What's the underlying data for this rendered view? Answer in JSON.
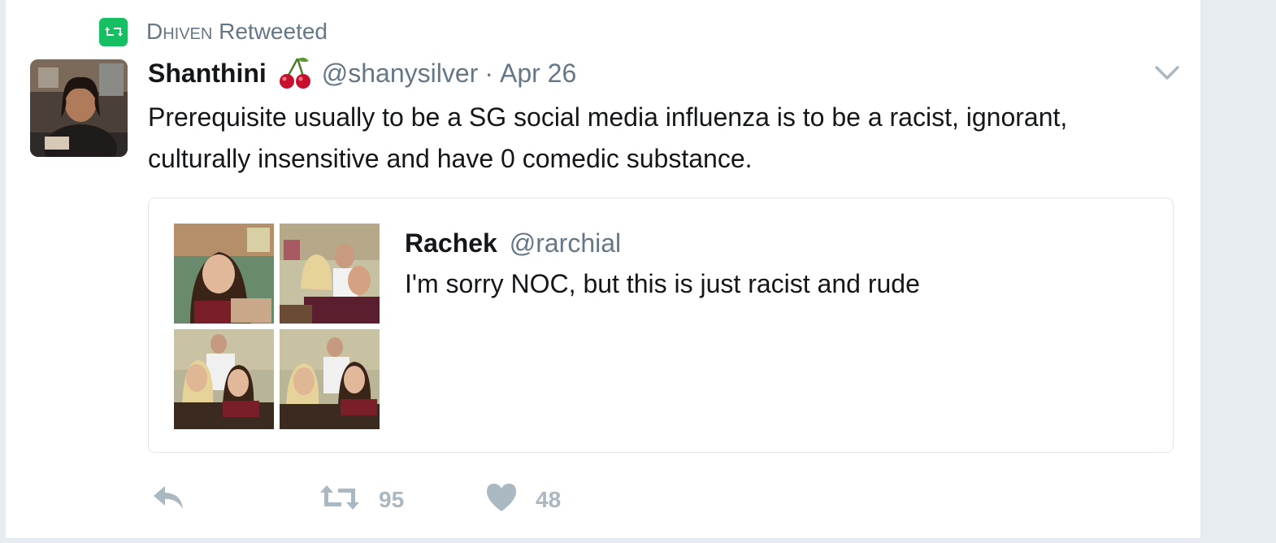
{
  "retweet_context": {
    "name": "Dhiven",
    "suffix": "Retweeted"
  },
  "tweet": {
    "fullname": "Shanthini",
    "emoji": "cherry-emoji",
    "screen_name": "@shanysilver",
    "separator": "·",
    "date": "Apr 26",
    "text": "Prerequisite usually to be a SG social media influenza is to be a racist, ignorant, culturally insensitive and have 0 comedic substance."
  },
  "quoted_tweet": {
    "fullname": "Rachek",
    "screen_name": "@rarchial",
    "text": "I'm sorry NOC, but this is just racist and rude",
    "media_count": 4
  },
  "actions": {
    "reply_icon": "reply-icon",
    "retweet_count": "95",
    "like_count": "48"
  },
  "colors": {
    "retweet_green": "#17bf63",
    "secondary_text": "#657786",
    "action_gray": "#aab8c2",
    "border": "#e1e8ed"
  }
}
